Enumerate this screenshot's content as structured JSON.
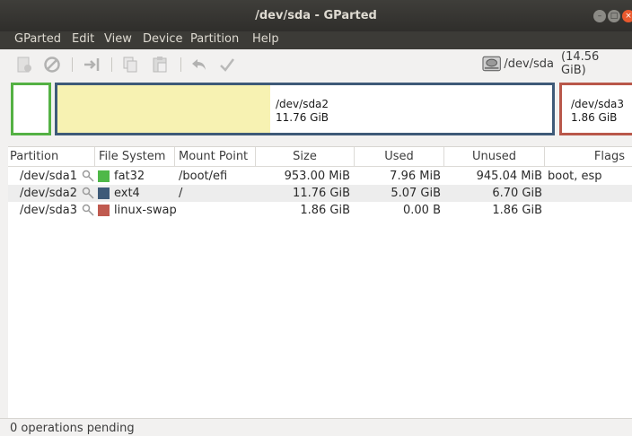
{
  "window": {
    "title": "/dev/sda - GParted",
    "controls": {
      "minimize": "–",
      "maximize": "□",
      "close": "×"
    }
  },
  "menubar": {
    "items": [
      "GParted",
      "Edit",
      "View",
      "Device",
      "Partition",
      "Help"
    ]
  },
  "toolbar": {
    "icons": [
      "new-partition-icon",
      "delete-icon",
      "resize-move-icon",
      "copy-icon",
      "paste-icon",
      "undo-icon",
      "apply-icon"
    ],
    "device": {
      "name": "/dev/sda",
      "size": "(14.56 GiB)",
      "arrow": "↕"
    }
  },
  "disk_visual": {
    "sda2": {
      "name": "/dev/sda2",
      "size": "11.76 GiB"
    },
    "sda3": {
      "name": "/dev/sda3",
      "size": "1.86 GiB"
    }
  },
  "table": {
    "headers": [
      "Partition",
      "File System",
      "Mount Point",
      "Size",
      "Used",
      "Unused",
      "Flags"
    ],
    "rows": [
      {
        "partition": "/dev/sda1",
        "filesystem": "fat32",
        "fs_color": "#4fb848",
        "mount": "/boot/efi",
        "size": "953.00 MiB",
        "used": "7.96 MiB",
        "unused": "945.04 MiB",
        "flags": "boot, esp"
      },
      {
        "partition": "/dev/sda2",
        "filesystem": "ext4",
        "fs_color": "#3e5a78",
        "mount": "/",
        "size": "11.76 GiB",
        "used": "5.07 GiB",
        "unused": "6.70 GiB",
        "flags": ""
      },
      {
        "partition": "/dev/sda3",
        "filesystem": "linux-swap",
        "fs_color": "#c05a4f",
        "mount": "",
        "size": "1.86 GiB",
        "used": "0.00 B",
        "unused": "1.86 GiB",
        "flags": ""
      }
    ]
  },
  "status": {
    "text": "0 operations pending"
  }
}
